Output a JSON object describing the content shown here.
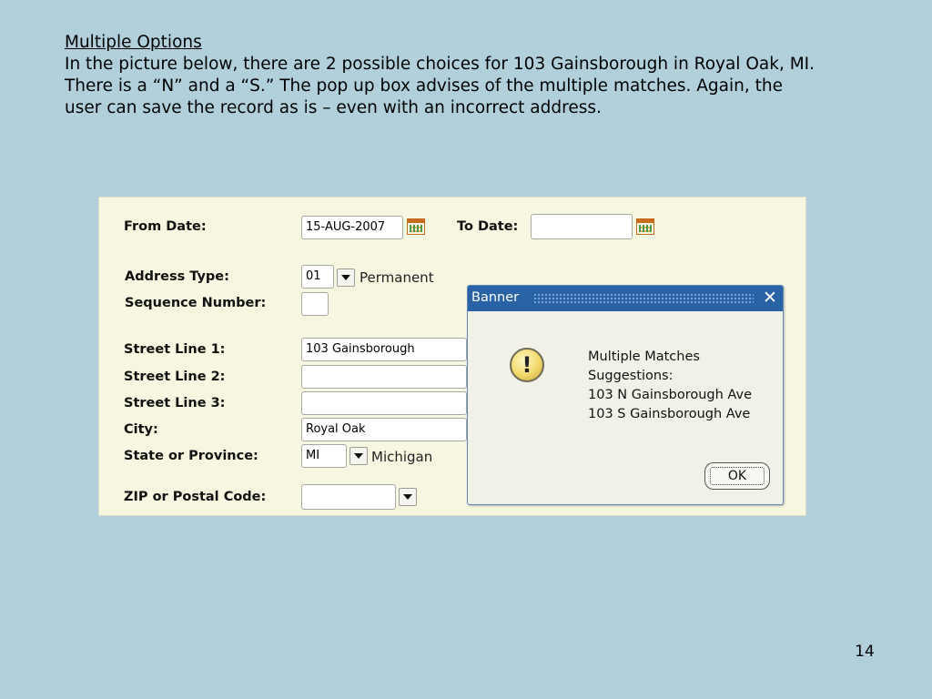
{
  "slide": {
    "heading": "Multiple Options",
    "lines": [
      "In the picture below, there are 2 possible choices for 103 Gainsborough in Royal Oak, MI.",
      "There is a “N” and a “S.”  The pop up box advises of the multiple matches.  Again, the",
      "user can save the record as is – even with an incorrect address."
    ],
    "page_number": "14"
  },
  "form": {
    "from_date": {
      "label": "From Date:",
      "value": "15-AUG-2007"
    },
    "to_date": {
      "label": "To Date:",
      "value": ""
    },
    "address_type": {
      "label": "Address Type:",
      "value": "01",
      "description": "Permanent"
    },
    "sequence_number": {
      "label": "Sequence Number:",
      "value": ""
    },
    "street_line_1": {
      "label": "Street Line 1:",
      "value": "103 Gainsborough"
    },
    "street_line_2": {
      "label": "Street Line 2:",
      "value": ""
    },
    "street_line_3": {
      "label": "Street Line 3:",
      "value": ""
    },
    "city": {
      "label": "City:",
      "value": "Royal Oak"
    },
    "state": {
      "label": "State or Province:",
      "value": "MI",
      "description": "Michigan"
    },
    "zip": {
      "label": "ZIP or Postal Code:",
      "value": ""
    }
  },
  "dialog": {
    "title": "Banner",
    "close_glyph": "✕",
    "icon": "exclamation-warning-icon",
    "icon_glyph": "!",
    "messages": [
      "Multiple Matches",
      "Suggestions:",
      "103 N Gainsborough Ave",
      "103 S Gainsborough Ave"
    ],
    "ok_label": "OK"
  }
}
